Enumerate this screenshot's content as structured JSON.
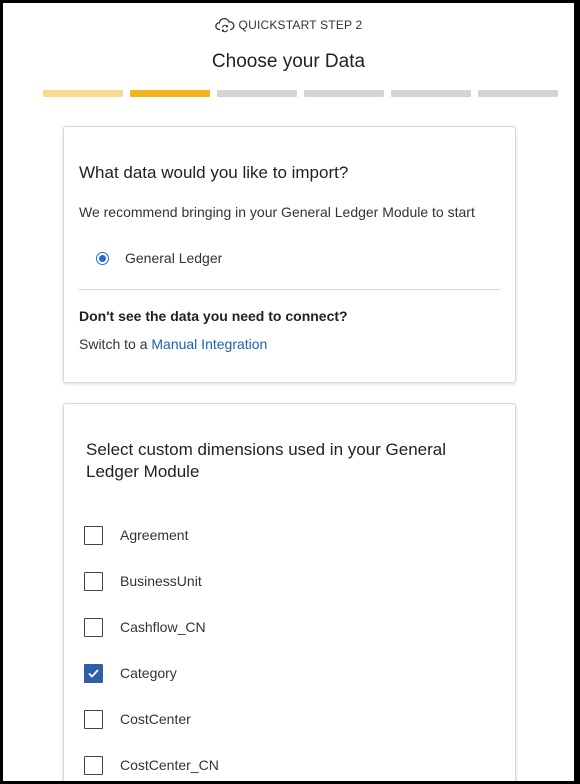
{
  "header": {
    "step_label": "QUICKSTART STEP 2",
    "icon": "cloud-sync-icon"
  },
  "page": {
    "title": "Choose your Data"
  },
  "progress": {
    "total_steps": 6,
    "current_step": 2,
    "colors": {
      "done": "#f6dc92",
      "active": "#f3b51c",
      "pending": "#d4d4d4"
    }
  },
  "import_card": {
    "question": "What data would you like to import?",
    "recommendation": "We recommend bringing in your General Ledger Module to start",
    "options": [
      {
        "label": "General Ledger",
        "selected": true
      }
    ],
    "missing_heading": "Don't see the data you need to connect?",
    "switch_prefix": "Switch to a ",
    "switch_link": "Manual Integration"
  },
  "dimensions_card": {
    "title": "Select custom dimensions used in your General Ledger Module",
    "items": [
      {
        "label": "Agreement",
        "checked": false
      },
      {
        "label": "BusinessUnit",
        "checked": false
      },
      {
        "label": "Cashflow_CN",
        "checked": false
      },
      {
        "label": "Category",
        "checked": true
      },
      {
        "label": "CostCenter",
        "checked": false
      },
      {
        "label": "CostCenter_CN",
        "checked": false
      }
    ]
  },
  "colors": {
    "accent": "#f3b51c",
    "link": "#1a63b4",
    "checkbox_checked": "#2e5fa8",
    "radio": "#1f6fd1"
  }
}
